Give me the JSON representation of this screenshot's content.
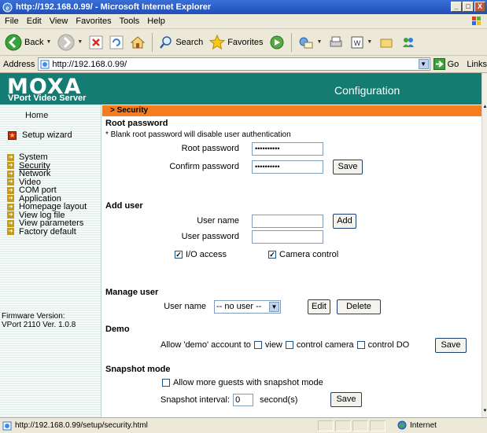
{
  "window": {
    "title": "http://192.168.0.99/ - Microsoft Internet Explorer",
    "controls": [
      "_",
      "□",
      "X"
    ]
  },
  "menu": [
    "File",
    "Edit",
    "View",
    "Favorites",
    "Tools",
    "Help"
  ],
  "toolbar": {
    "back_label": "Back",
    "search_label": "Search",
    "favorites_label": "Favorites"
  },
  "address": {
    "label": "Address",
    "url": "http://192.168.0.99/",
    "go_label": "Go",
    "links_label": "Links"
  },
  "header": {
    "logo": "MOXA",
    "logo_sub": "VPort Video Server",
    "title": "Configuration"
  },
  "sidebar": {
    "home": "Home",
    "setup_wizard": "Setup wizard",
    "items": [
      {
        "label": "System"
      },
      {
        "label": "Security"
      },
      {
        "label": "Network"
      },
      {
        "label": "Video"
      },
      {
        "label": "COM port"
      },
      {
        "label": "Application"
      },
      {
        "label": "Homepage layout"
      },
      {
        "label": "View log file"
      },
      {
        "label": "View parameters"
      },
      {
        "label": "Factory default"
      }
    ],
    "firmware_label": "Firmware Version:",
    "firmware_value": "VPort 2110 Ver. 1.0.8"
  },
  "page": {
    "breadcrumb": "> Security",
    "root_password": {
      "heading": "Root password",
      "note": "* Blank root password will disable user authentication",
      "root_label": "Root password",
      "root_value": "••••••••••",
      "confirm_label": "Confirm password",
      "confirm_value": "••••••••••",
      "save": "Save"
    },
    "add_user": {
      "heading": "Add user",
      "name_label": "User name",
      "password_label": "User password",
      "add": "Add",
      "io_access": "I/O access",
      "io_checked": true,
      "camera_control": "Camera control",
      "camera_checked": true
    },
    "manage_user": {
      "heading": "Manage user",
      "name_label": "User name",
      "selected": "-- no user --",
      "edit": "Edit",
      "delete": "Delete"
    },
    "demo": {
      "heading": "Demo",
      "prefix": "Allow 'demo' account to",
      "view": "view",
      "control_camera": "control camera",
      "control_do": "control DO",
      "save": "Save"
    },
    "snapshot": {
      "heading": "Snapshot mode",
      "allow_more": "Allow more guests with snapshot mode",
      "interval_label": "Snapshot interval:",
      "interval_value": "0",
      "unit": "second(s)",
      "save": "Save"
    }
  },
  "status": {
    "url": "http://192.168.0.99/setup/security.html",
    "zone": "Internet"
  },
  "colors": {
    "header": "#157c74",
    "section_bar": "#f57d20",
    "title_bar": "#2a5fcc"
  }
}
